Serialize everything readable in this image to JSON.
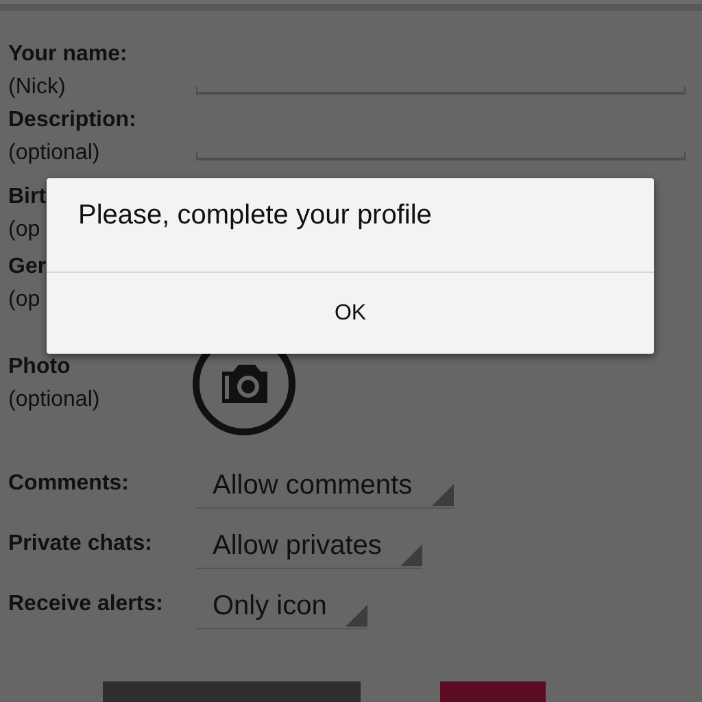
{
  "form": {
    "fields": [
      {
        "kind": "text",
        "label": "Your name:",
        "hint": "(Nick)"
      },
      {
        "kind": "text",
        "label": "Description:",
        "hint": "(optional)"
      },
      {
        "kind": "covered",
        "label": "Birt",
        "hint": "(op"
      },
      {
        "kind": "covered",
        "label": "Ger",
        "hint": "(op"
      },
      {
        "kind": "photo",
        "label": "Photo",
        "hint": "(optional)"
      }
    ],
    "settings": [
      {
        "label": "Comments:",
        "value": "Allow comments"
      },
      {
        "label": "Private chats:",
        "value": "Allow privates"
      },
      {
        "label": "Receive alerts:",
        "value": "Only icon"
      }
    ]
  },
  "bottom_buttons": [
    {
      "color": "#2e2e2e"
    },
    {
      "color": "#5c0d24"
    }
  ],
  "dialog": {
    "message": "Please, complete your profile",
    "buttons": [
      "OK"
    ]
  }
}
